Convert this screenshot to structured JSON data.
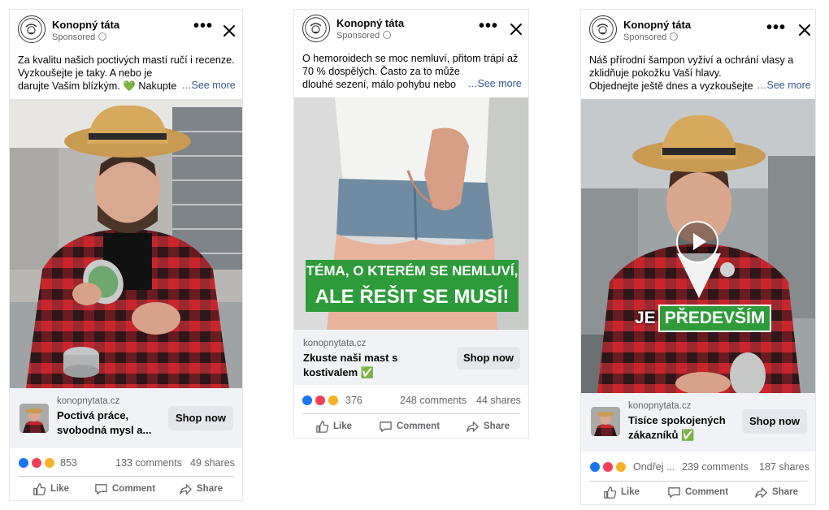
{
  "ads": [
    {
      "page_name": "Konopný táta",
      "sponsored": "Sponsored",
      "body_lines": [
        "Za kvalitu našich poctivých mastí ručí i recenze.",
        "Vyzkoušejte je taky. A nebo je",
        "darujte Vašim blízkým. 💚 Nakupte"
      ],
      "see_more": "…See more",
      "domain": "konopnytata.cz",
      "headline_lines": [
        "Poctivá práce,",
        "svobodná mysl a..."
      ],
      "cta": "Shop now",
      "reactions_count": "853",
      "comments": "133 comments",
      "shares": "49 shares",
      "actions": {
        "like": "Like",
        "comment": "Comment",
        "share": "Share"
      }
    },
    {
      "page_name": "Konopný táta",
      "sponsored": "Sponsored",
      "body_lines": [
        "O hemoroidech se moc nemluví, přitom trápí až",
        "70 % dospělých. Často za to může",
        "dlouhé sezení, málo pohybu nebo"
      ],
      "see_more": "…See more",
      "overlay_lines": [
        "TÉMA, O KTERÉM SE NEMLUVÍ,",
        "ALE ŘEŠIT SE MUSÍ!"
      ],
      "domain": "konopnytata.cz",
      "headline_lines": [
        "Zkuste naši mast s",
        "kostivalem ✅"
      ],
      "cta": "Shop now",
      "reactions_count": "376",
      "comments": "248 comments",
      "shares": "44 shares",
      "actions": {
        "like": "Like",
        "comment": "Comment",
        "share": "Share"
      }
    },
    {
      "page_name": "Konopný táta",
      "sponsored": "Sponsored",
      "body_lines": [
        "Náš přírodní šampon vyživí a ochrání vlasy a",
        "zklidňuje pokožku Vaší hlavy.",
        "Objednejte ještě dnes a vyzkoušejte"
      ],
      "see_more": "…See more",
      "caption_prefix": "JE",
      "caption_highlight": "PŘEDEVŠÍM",
      "domain": "konopnytata.cz",
      "headline_lines": [
        "Tisíce spokojených",
        "zákazníků ✅"
      ],
      "cta": "Shop now",
      "reactions_name": "Ondřej ...",
      "comments": "239 comments",
      "shares": "187 shares",
      "actions": {
        "like": "Like",
        "comment": "Comment",
        "share": "Share"
      }
    }
  ],
  "colors": {
    "link": "#385898",
    "like_blue": "#1877f2",
    "love_red": "#f33e58",
    "haha_yellow": "#f7b125",
    "overlay_green": "#2e9b3a",
    "cta_bg": "#f0f2f5",
    "button_bg": "#e4e6eb",
    "flannel_red": "#c8262c"
  }
}
